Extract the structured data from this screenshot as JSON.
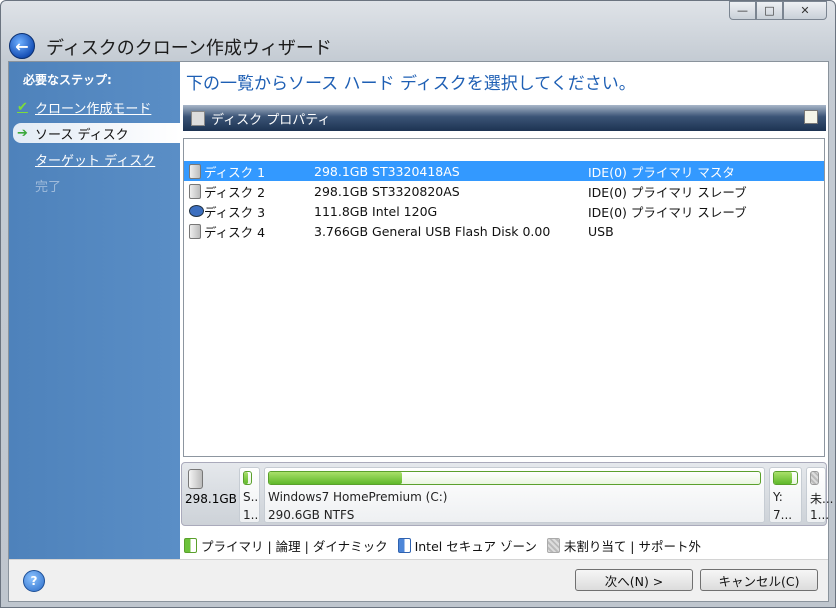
{
  "window": {
    "title": "ディスクのクローン作成ウィザード",
    "controls": {
      "minimize": "—",
      "maximize": "□",
      "close": "✕"
    }
  },
  "sidebar": {
    "header": "必要なステップ:",
    "steps": [
      {
        "label": "クローン作成モード",
        "state": "done"
      },
      {
        "label": "ソース ディスク",
        "state": "active"
      },
      {
        "label": "ターゲット ディスク",
        "state": "link"
      },
      {
        "label": "完了",
        "state": "disabled"
      }
    ]
  },
  "main": {
    "heading": "下の一覧からソース ハード ディスクを選択してください。",
    "properties_label": "ディスク プロパティ",
    "disks": [
      {
        "name": "ディスク 1",
        "size": "298.1GB ST3320418AS",
        "interface": "IDE(0) プライマリ マスタ",
        "icon": "hdd-icon",
        "selected": true
      },
      {
        "name": "ディスク 2",
        "size": "298.1GB ST3320820AS",
        "interface": "IDE(0) プライマリ スレーブ",
        "icon": "hdd-icon",
        "selected": false
      },
      {
        "name": "ディスク 3",
        "size": "111.8GB Intel 120G",
        "interface": "IDE(0) プライマリ スレーブ",
        "icon": "intel-ssd-icon",
        "selected": false
      },
      {
        "name": "ディスク 4",
        "size": "3.766GB General USB Flash Disk 0.00",
        "interface": "USB",
        "icon": "hdd-icon",
        "selected": false
      }
    ],
    "partition_map": {
      "disk_size": "298.1GB",
      "partitions": [
        {
          "label": "S...",
          "size": "1...",
          "fill": 0.5
        },
        {
          "label": "Windows7 HomePremium (C:)",
          "size": "290.6GB  NTFS",
          "fill": 0.27
        },
        {
          "label": "Y:",
          "size": "7...",
          "fill": 0.8
        },
        {
          "label": "未...",
          "size": "1...",
          "fill": 0
        }
      ]
    },
    "legend": {
      "primary": "プライマリ | 論理 | ダイナミック",
      "intel": "Intel セキュア ゾーン",
      "unallocated": "未割り当て | サポート外"
    }
  },
  "footer": {
    "help": "?",
    "next": "次へ(N) >",
    "cancel": "キャンセル(C)"
  },
  "colors": {
    "selection": "#3399ff",
    "sidebar": "#4e82bb",
    "heading": "#1e5fb4",
    "primary": "#5fb82a"
  }
}
